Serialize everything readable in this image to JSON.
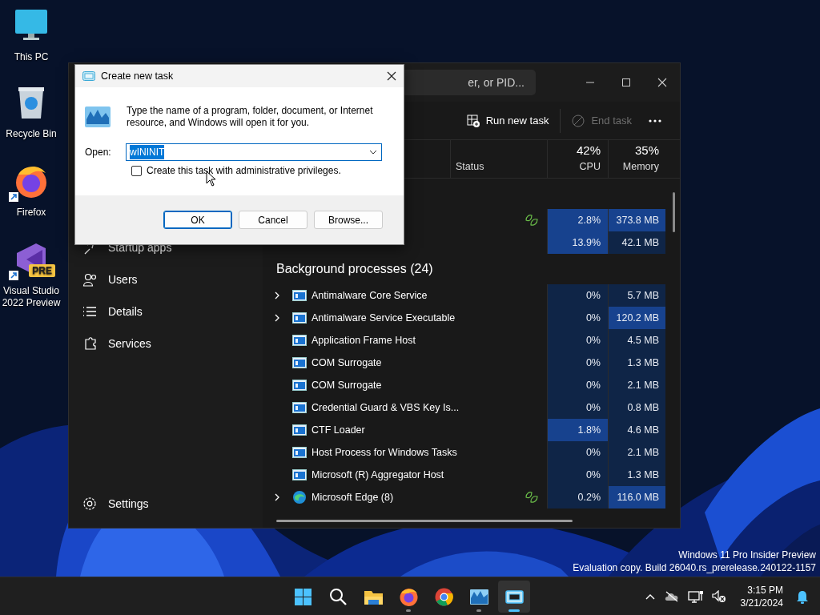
{
  "desktop_icons": [
    {
      "kind": "pc",
      "label": "This PC",
      "shortcut": false
    },
    {
      "kind": "bin",
      "label": "Recycle Bin",
      "shortcut": false
    },
    {
      "kind": "firefox",
      "label": "Firefox",
      "shortcut": true
    },
    {
      "kind": "vs",
      "label": "Visual Studio 2022 Preview",
      "badge": "PRE",
      "shortcut": true
    }
  ],
  "task_manager": {
    "search": {
      "placeholder": "er, or PID..."
    },
    "toolbar": [
      {
        "kind": "run",
        "label": "Run new task",
        "disabled": false
      },
      {
        "kind": "end",
        "label": "End task",
        "disabled": true
      }
    ],
    "nav": [
      {
        "kind": "startup",
        "label": "Startup apps"
      },
      {
        "kind": "users",
        "label": "Users"
      },
      {
        "kind": "details",
        "label": "Details"
      },
      {
        "kind": "services",
        "label": "Services"
      }
    ],
    "settings": "Settings",
    "columns": {
      "status": "Status",
      "cpu_total": "42%",
      "cpu": "CPU",
      "memory_total": "35%",
      "memory": "Memory"
    },
    "app_rows": [
      {
        "eco": true,
        "cpu": "2.8%",
        "memory": "373.8 MB",
        "cpu_highlighted": true,
        "memory_highlighted": true
      },
      {
        "eco": false,
        "cpu": "13.9%",
        "memory": "42.1 MB",
        "cpu_highlighted": true,
        "memory_highlighted": false
      }
    ],
    "group": "Background processes (24)",
    "processes": [
      {
        "name": "Antimalware Core Service",
        "kind": "service",
        "expandable": true,
        "eco": false,
        "cpu": "0%",
        "memory": "5.7 MB",
        "cpu_highlighted": false,
        "memory_highlighted": false
      },
      {
        "name": "Antimalware Service Executable",
        "kind": "service",
        "expandable": true,
        "eco": false,
        "cpu": "0%",
        "memory": "120.2 MB",
        "cpu_highlighted": false,
        "memory_highlighted": true
      },
      {
        "name": "Application Frame Host",
        "kind": "service",
        "expandable": false,
        "eco": false,
        "cpu": "0%",
        "memory": "4.5 MB",
        "cpu_highlighted": false,
        "memory_highlighted": false
      },
      {
        "name": "COM Surrogate",
        "kind": "service",
        "expandable": false,
        "eco": false,
        "cpu": "0%",
        "memory": "1.3 MB",
        "cpu_highlighted": false,
        "memory_highlighted": false
      },
      {
        "name": "COM Surrogate",
        "kind": "service",
        "expandable": false,
        "eco": false,
        "cpu": "0%",
        "memory": "2.1 MB",
        "cpu_highlighted": false,
        "memory_highlighted": false
      },
      {
        "name": "Credential Guard & VBS Key Is...",
        "kind": "service",
        "expandable": false,
        "eco": false,
        "cpu": "0%",
        "memory": "0.8 MB",
        "cpu_highlighted": false,
        "memory_highlighted": false
      },
      {
        "name": "CTF Loader",
        "kind": "service",
        "expandable": false,
        "eco": false,
        "cpu": "1.8%",
        "memory": "4.6 MB",
        "cpu_highlighted": true,
        "memory_highlighted": false
      },
      {
        "name": "Host Process for Windows Tasks",
        "kind": "service",
        "expandable": false,
        "eco": false,
        "cpu": "0%",
        "memory": "2.1 MB",
        "cpu_highlighted": false,
        "memory_highlighted": false
      },
      {
        "name": "Microsoft (R) Aggregator Host",
        "kind": "service",
        "expandable": false,
        "eco": false,
        "cpu": "0%",
        "memory": "1.3 MB",
        "cpu_highlighted": false,
        "memory_highlighted": false
      },
      {
        "name": "Microsoft Edge (8)",
        "kind": "edge",
        "expandable": true,
        "eco": true,
        "cpu": "0.2%",
        "memory": "116.0 MB",
        "cpu_highlighted": false,
        "memory_highlighted": true
      }
    ]
  },
  "dialog": {
    "title": "Create new task",
    "message": "Type the name of a program, folder, document, or Internet resource, and Windows will open it for you.",
    "open_label": "Open:",
    "value": "wININIT",
    "value_selected": true,
    "admin_checkbox": {
      "label": "Create this task with administrative privileges.",
      "checked": false
    },
    "buttons": [
      {
        "label": "OK",
        "default": true
      },
      {
        "label": "Cancel",
        "default": false
      },
      {
        "label": "Browse...",
        "default": false
      }
    ]
  },
  "watermark": [
    "Windows 11 Pro Insider Preview",
    "Evaluation copy. Build 26040.rs_prerelease.240122-1157"
  ],
  "taskbar": {
    "apps": [
      {
        "kind": "start",
        "running": false,
        "selected": false
      },
      {
        "kind": "search",
        "running": false,
        "selected": false
      },
      {
        "kind": "explorer",
        "running": false,
        "selected": false
      },
      {
        "kind": "firefox",
        "running": true,
        "selected": false
      },
      {
        "kind": "chrome",
        "running": false,
        "selected": false
      },
      {
        "kind": "taskmgr",
        "running": true,
        "selected": false
      },
      {
        "kind": "run",
        "running": true,
        "selected": true
      }
    ],
    "time": "3:15 PM",
    "date": "3/21/2024"
  }
}
